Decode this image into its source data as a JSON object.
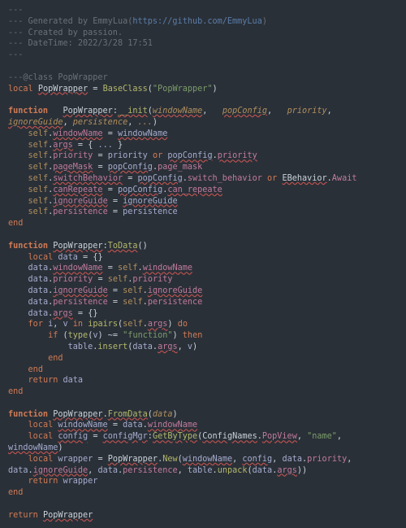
{
  "file": {
    "header": {
      "sep": "---",
      "generated_prefix": "--- Generated by ",
      "generator": "EmmyLua",
      "url": "https://github.com/EmmyLua",
      "created_by": "--- Created by passion.",
      "datetime_label": "--- DateTime: ",
      "datetime": "2022/3/28 17:51"
    },
    "class_annotation": "---@class PopWrapper",
    "decl_local": "local",
    "class_name": "PopWrapper",
    "baseclass_call": "BaseClass",
    "baseclass_arg": "\"PopWrapper\"",
    "func_init": {
      "kw": "function",
      "name_class": "PopWrapper",
      "name_method": "__init",
      "params": [
        "windowName",
        "popConfig",
        "priority",
        "ignoreGuide",
        "persistence",
        "..."
      ],
      "body": {
        "l1_field": "windowName",
        "l1_rhs": "windowName",
        "l2_field": "args",
        "l2_rhs_open": "{ ",
        "l2_varg": "...",
        "l2_rhs_close": " }",
        "l3_field": "priority",
        "l3_rhs_a": "priority",
        "l3_or": "or",
        "l3_rhs_b": "popConfig",
        "l3_rhs_b_f": "priority",
        "l4_field": "pageMask",
        "l4_rhs_a": "popConfig",
        "l4_rhs_a_f": "page_mask",
        "l5_field": "switchBehavior",
        "l5_rhs_a": "popConfig",
        "l5_rhs_a_f": "switch_behavior",
        "l5_or": "or",
        "l5_rhs_b": "EBehavior",
        "l5_rhs_b_f": "Await",
        "l6_field": "canRepeate",
        "l6_rhs_a": "popConfig",
        "l6_rhs_a_f": "can_repeate",
        "l7_field": "ignoreGuide",
        "l7_rhs": "ignoreGuide",
        "l8_field": "persistence",
        "l8_rhs": "persistence"
      },
      "end": "end"
    },
    "func_todata": {
      "kw": "function",
      "name_class": "PopWrapper",
      "name_method": "ToData",
      "l1_local": "local",
      "l1_var": "data",
      "l1_rhs": "{}",
      "l2_obj": "data",
      "l2_field": "windowName",
      "l2_rhs_obj": "self",
      "l2_rhs_field": "windowName",
      "l3_obj": "data",
      "l3_field": "priority",
      "l3_rhs_obj": "self",
      "l3_rhs_field": "priority",
      "l4_obj": "data",
      "l4_field": "ignoreGuide",
      "l4_rhs_obj": "self",
      "l4_rhs_field": "ignoreGuide",
      "l5_obj": "data",
      "l5_field": "persistence",
      "l5_rhs_obj": "self",
      "l5_rhs_field": "persistence",
      "l6_obj": "data",
      "l6_field": "args",
      "l6_rhs": "{}",
      "loop_for": "for",
      "loop_i": "i",
      "loop_v": "v",
      "loop_in": "in",
      "loop_fn": "ipairs",
      "loop_arg_obj": "self",
      "loop_arg_field": "args",
      "loop_do": "do",
      "if_kw": "if",
      "if_type": "type",
      "if_arg": "v",
      "if_neq": "~=",
      "if_str": "\"function\"",
      "if_then": "then",
      "ins_obj": "table",
      "ins_fn": "insert",
      "ins_arg1_obj": "data",
      "ins_arg1_field": "args",
      "ins_arg2": "v",
      "end1": "end",
      "end2": "end",
      "ret": "return",
      "ret_var": "data",
      "end3": "end"
    },
    "func_fromdata": {
      "kw": "function",
      "name_class": "PopWrapper",
      "name_method": "FromData",
      "param": "data",
      "l1_local": "local",
      "l1_var": "windowName",
      "l1_rhs_obj": "data",
      "l1_rhs_field": "windowName",
      "l2_local": "local",
      "l2_var": "config",
      "l2_rhs_obj": "configMgr",
      "l2_rhs_fn": "GetByType",
      "l2_arg1_obj": "ConfigNames",
      "l2_arg1_field": "PopView",
      "l2_arg2": "\"name\"",
      "l2_arg3": "windowName",
      "l3_local": "local",
      "l3_var": "wrapper",
      "l3_rhs_obj": "PopWrapper",
      "l3_rhs_fn": "New",
      "l3_arg1": "windowName",
      "l3_arg2": "config",
      "l3_arg3_obj": "data",
      "l3_arg3_field": "priority",
      "l3_arg4_obj": "data",
      "l3_arg4_field": "ignoreGuide",
      "l3_arg5_obj": "data",
      "l3_arg5_field": "persistence",
      "l3_arg6_obj": "table",
      "l3_arg6_fn": "unpack",
      "l3_arg6_arg_obj": "data",
      "l3_arg6_arg_field": "args",
      "ret": "return",
      "ret_var": "wrapper",
      "end": "end"
    },
    "ret_module": {
      "ret": "return",
      "name": "PopWrapper"
    }
  }
}
